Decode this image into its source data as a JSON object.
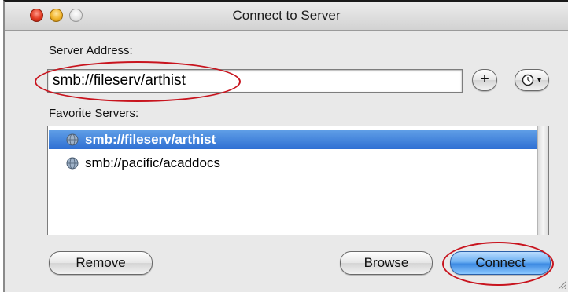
{
  "window": {
    "title": "Connect to Server"
  },
  "server_address": {
    "label": "Server Address:",
    "value": "smb://fileserv/arthist",
    "add_button_label": "+",
    "recent_button_icon": "clock-icon"
  },
  "favorites": {
    "label": "Favorite Servers:",
    "items": [
      {
        "label": "smb://fileserv/arthist",
        "selected": true,
        "icon": "globe-icon"
      },
      {
        "label": "smb://pacific/acaddocs",
        "selected": false,
        "icon": "globe-icon"
      }
    ]
  },
  "buttons": {
    "remove": "Remove",
    "browse": "Browse",
    "connect": "Connect"
  },
  "colors": {
    "selection": "#3a78d8",
    "default_button": "#5aa2ee",
    "annotation": "#c8141e"
  }
}
